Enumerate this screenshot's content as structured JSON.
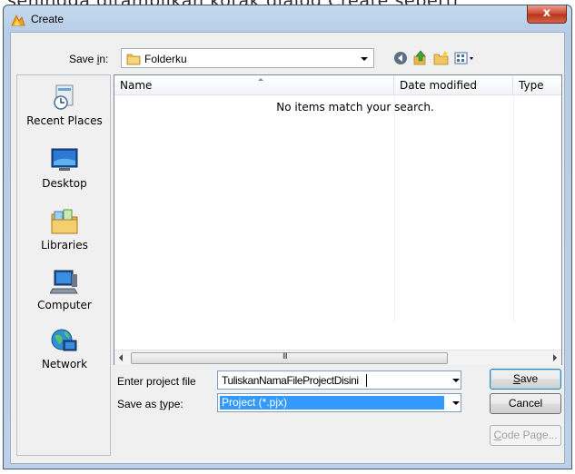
{
  "background_caption": "sehingga ditampilkan kotak dialog Create seperti",
  "window": {
    "title": "Create",
    "close_label": "x"
  },
  "save_in": {
    "label": "Save in:",
    "value": "Folderku"
  },
  "toolbar": [
    "back-icon",
    "up-folder-icon",
    "new-folder-icon",
    "views-menu-icon"
  ],
  "places": [
    {
      "label": "Recent Places",
      "icon": "recent-places-icon"
    },
    {
      "label": "Desktop",
      "icon": "desktop-icon"
    },
    {
      "label": "Libraries",
      "icon": "libraries-icon"
    },
    {
      "label": "Computer",
      "icon": "computer-icon"
    },
    {
      "label": "Network",
      "icon": "network-icon"
    }
  ],
  "file_list": {
    "columns": [
      "Name",
      "Date modified",
      "Type"
    ],
    "empty_message": "No items match your search.",
    "scroll_grip": "III"
  },
  "form": {
    "file_label": "Enter project file",
    "file_value": "TuliskanNamaFileProjectDisini",
    "type_label": "Save as type:",
    "type_value": "Project (*.pjx)"
  },
  "buttons": {
    "save": "Save",
    "cancel": "Cancel",
    "code_page": "Code Page..."
  },
  "colors": {
    "title_gradient": "#c6d9ee",
    "selection": "#3399ff",
    "close_red": "#c9462e"
  }
}
